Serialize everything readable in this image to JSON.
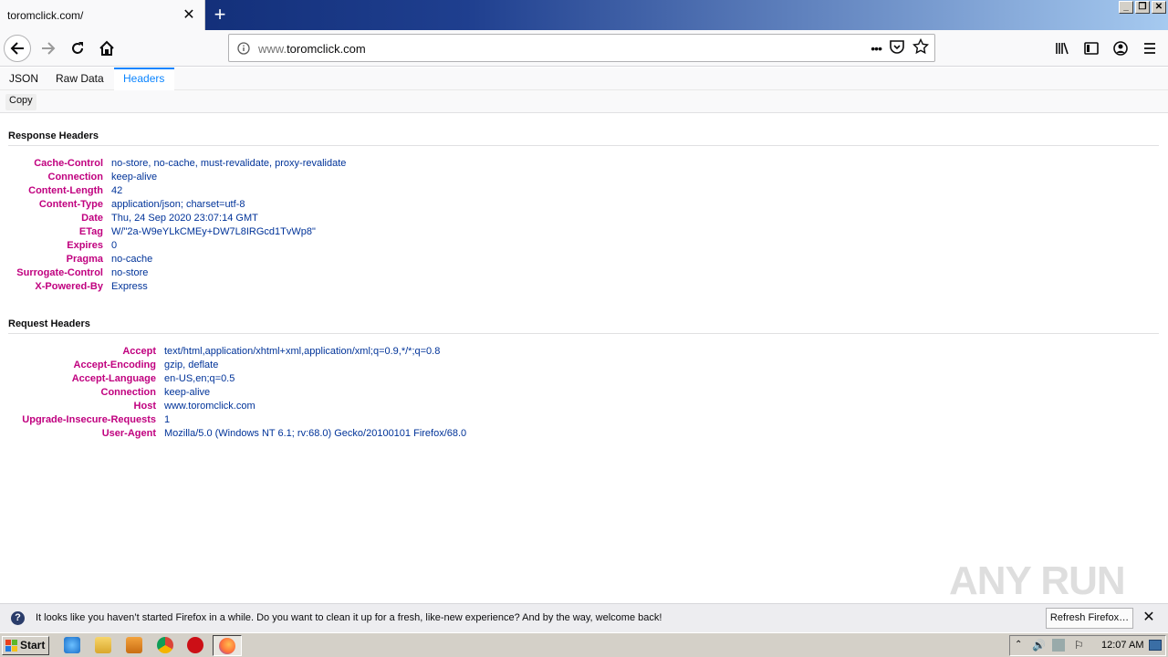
{
  "window": {
    "tab_title": "toromclick.com/",
    "new_tab_label": "+"
  },
  "nav": {
    "url_host": "www.",
    "url_domain": "toromclick.com",
    "page_actions_label": "•••"
  },
  "viewer": {
    "tabs": [
      "JSON",
      "Raw Data",
      "Headers"
    ],
    "active_tab": "Headers",
    "copy_label": "Copy"
  },
  "response_headers": {
    "title": "Response Headers",
    "rows": [
      {
        "name": "Cache-Control",
        "value": "no-store, no-cache, must-revalidate, proxy-revalidate"
      },
      {
        "name": "Connection",
        "value": "keep-alive"
      },
      {
        "name": "Content-Length",
        "value": "42"
      },
      {
        "name": "Content-Type",
        "value": "application/json; charset=utf-8"
      },
      {
        "name": "Date",
        "value": "Thu, 24 Sep 2020 23:07:14 GMT"
      },
      {
        "name": "ETag",
        "value": "W/\"2a-W9eYLkCMEy+DW7L8IRGcd1TvWp8\""
      },
      {
        "name": "Expires",
        "value": "0"
      },
      {
        "name": "Pragma",
        "value": "no-cache"
      },
      {
        "name": "Surrogate-Control",
        "value": "no-store"
      },
      {
        "name": "X-Powered-By",
        "value": "Express"
      }
    ]
  },
  "request_headers": {
    "title": "Request Headers",
    "rows": [
      {
        "name": "Accept",
        "value": "text/html,application/xhtml+xml,application/xml;q=0.9,*/*;q=0.8"
      },
      {
        "name": "Accept-Encoding",
        "value": "gzip, deflate"
      },
      {
        "name": "Accept-Language",
        "value": "en-US,en;q=0.5"
      },
      {
        "name": "Connection",
        "value": "keep-alive"
      },
      {
        "name": "Host",
        "value": "www.toromclick.com"
      },
      {
        "name": "Upgrade-Insecure-Requests",
        "value": "1"
      },
      {
        "name": "User-Agent",
        "value": "Mozilla/5.0 (Windows NT 6.1; rv:68.0) Gecko/20100101 Firefox/68.0"
      }
    ]
  },
  "notification": {
    "text": "It looks like you haven’t started Firefox in a while. Do you want to clean it up for a fresh, like-new experience? And by the way, welcome back!",
    "button_label": "Refresh Firefox…"
  },
  "watermark": "ANY RUN",
  "taskbar": {
    "start_label": "Start",
    "clock": "12:07 AM"
  }
}
